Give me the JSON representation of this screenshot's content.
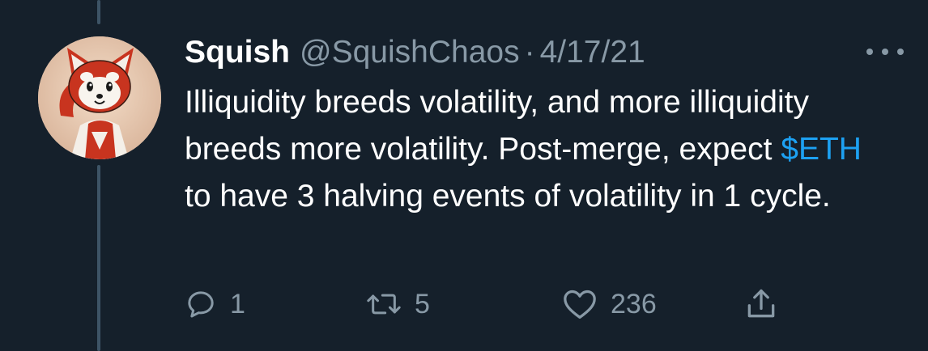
{
  "tweet": {
    "display_name": "Squish",
    "handle": "@SquishChaos",
    "separator": "·",
    "date": "4/17/21",
    "text_before": "Illiquidity breeds volatility, and more illiquidity breeds more volatility. Post-merge, expect ",
    "cashtag": "$ETH",
    "text_after": " to have 3 halving events of volatility in 1 cycle.",
    "avatar": "red-panda-avatar"
  },
  "actions": {
    "reply_count": "1",
    "retweet_count": "5",
    "like_count": "236"
  },
  "icons": {
    "reply": "reply-icon",
    "retweet": "retweet-icon",
    "like": "heart-icon",
    "share": "share-icon",
    "more": "more-icon"
  },
  "colors": {
    "background": "#15202b",
    "text": "#ffffff",
    "secondary": "#8899a6",
    "link": "#1da1f2",
    "thread_line": "#3d5466"
  }
}
